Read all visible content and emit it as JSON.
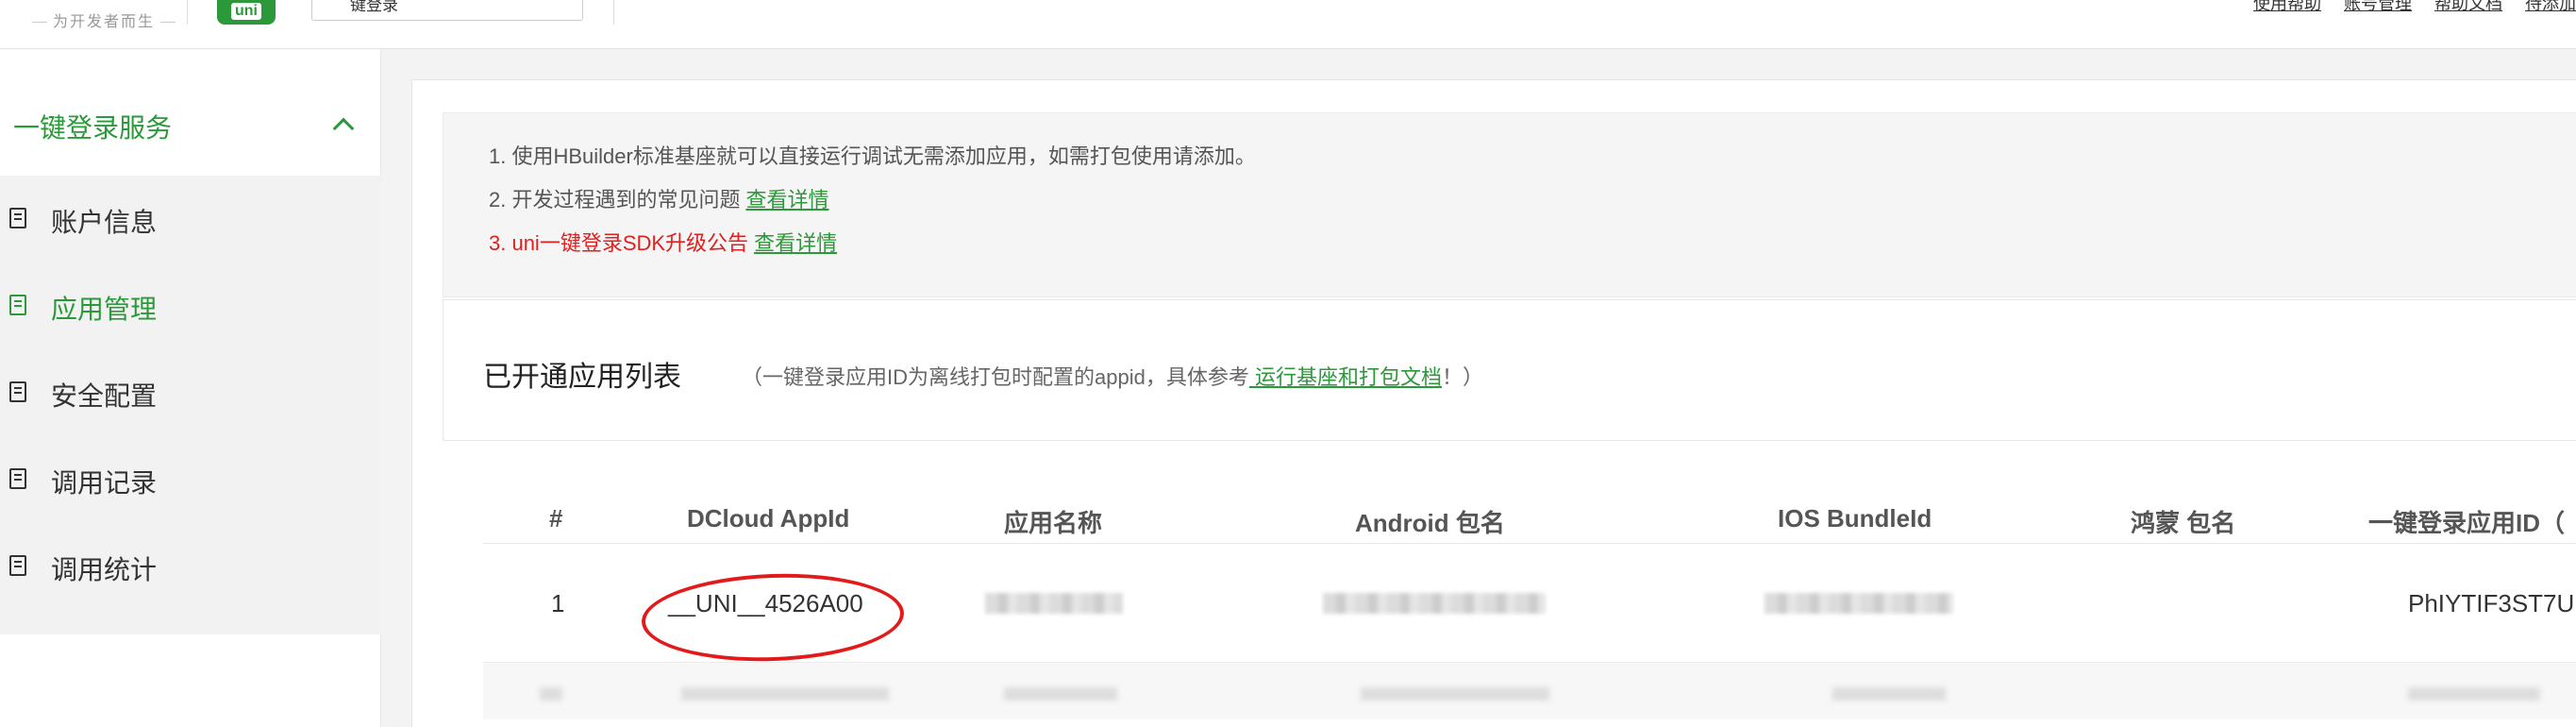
{
  "header": {
    "logo_tagline": "为开发者而生",
    "logo_text": "uni",
    "app_select": "键登录",
    "links": [
      "使用帮助",
      "账号管理",
      "帮助文档",
      "待添加"
    ]
  },
  "sidebar": {
    "group_title": "一键登录服务",
    "items": [
      {
        "label": "账户信息",
        "active": false
      },
      {
        "label": "应用管理",
        "active": true
      },
      {
        "label": "安全配置",
        "active": false
      },
      {
        "label": "调用记录",
        "active": false
      },
      {
        "label": "调用统计",
        "active": false
      }
    ]
  },
  "notice": {
    "line1": "1. 使用HBuilder标准基座就可以直接运行调试无需添加应用，如需打包使用请添加。",
    "line2": "2. 开发过程遇到的常见问题",
    "line2_link": "查看详情",
    "line3": "3. uni一键登录SDK升级公告",
    "line3_link": "查看详情"
  },
  "list": {
    "title": "已开通应用列表",
    "subtitle_pre": "（一键登录应用ID为离线打包时配置的appid，具体参考",
    "subtitle_link": " 运行基座和打包文档",
    "subtitle_post": "！）"
  },
  "table": {
    "columns": [
      "#",
      "DCloud AppId",
      "应用名称",
      "Android 包名",
      "IOS BundleId",
      "鸿蒙 包名",
      "一键登录应用ID（"
    ],
    "rows": [
      {
        "index": "1",
        "appid": "__UNI__4526A00",
        "login_app_id": "PhIYTIF3ST7U"
      }
    ]
  },
  "colors": {
    "accent": "#2b9939",
    "alert": "#e01f1f",
    "annotation": "#e31a1a"
  }
}
